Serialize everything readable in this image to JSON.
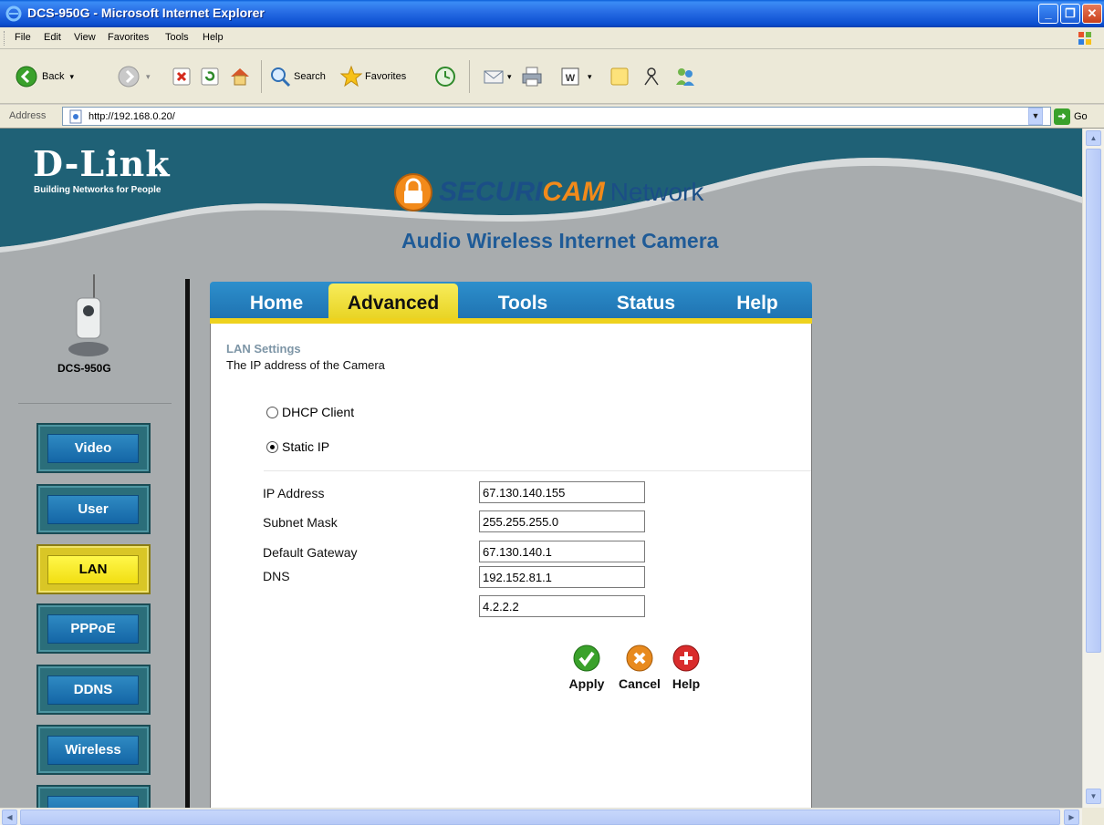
{
  "window": {
    "title": "DCS-950G - Microsoft Internet Explorer",
    "minimize": "_",
    "restore": "❐",
    "close": "✕"
  },
  "menu": [
    "File",
    "Edit",
    "View",
    "Favorites",
    "Tools",
    "Help"
  ],
  "toolbar": {
    "back": "Back",
    "search": "Search",
    "favorites": "Favorites"
  },
  "address": {
    "label": "Address",
    "url": "http://192.168.0.20/",
    "go": "Go"
  },
  "brand": {
    "logo": "D-Link",
    "tagline": "Building Networks for People",
    "product_line_a": "SECURI",
    "product_line_b": "CAM",
    "product_line_c": "Network",
    "product_title": "Audio Wireless Internet Camera"
  },
  "device": {
    "model": "DCS-950G"
  },
  "nav": [
    "Video",
    "User",
    "LAN",
    "PPPoE",
    "DDNS",
    "Wireless"
  ],
  "nav_active": "LAN",
  "tabs": [
    "Home",
    "Advanced",
    "Tools",
    "Status",
    "Help"
  ],
  "tab_active": "Advanced",
  "lan": {
    "title": "LAN Settings",
    "subtitle": "The IP address of the Camera",
    "dhcp_label": "DHCP Client",
    "static_label": "Static IP",
    "selected_mode": "Static IP",
    "fields": {
      "ip_label": "IP Address",
      "ip_value": "67.130.140.155",
      "mask_label": "Subnet Mask",
      "mask_value": "255.255.255.0",
      "gateway_label": "Default Gateway",
      "gateway_value": "67.130.140.1",
      "dns_label": "DNS",
      "dns1_value": "192.152.81.1",
      "dns2_value": "4.2.2.2"
    }
  },
  "actions": {
    "apply": "Apply",
    "cancel": "Cancel",
    "help": "Help"
  },
  "colors": {
    "banner_dark": "#1f6176",
    "accent_yellow": "#eed21e",
    "tab_blue": "#1d6fae",
    "apply_green": "#3aa12b",
    "cancel_orange": "#e88a1e",
    "help_red": "#d92c2c"
  }
}
